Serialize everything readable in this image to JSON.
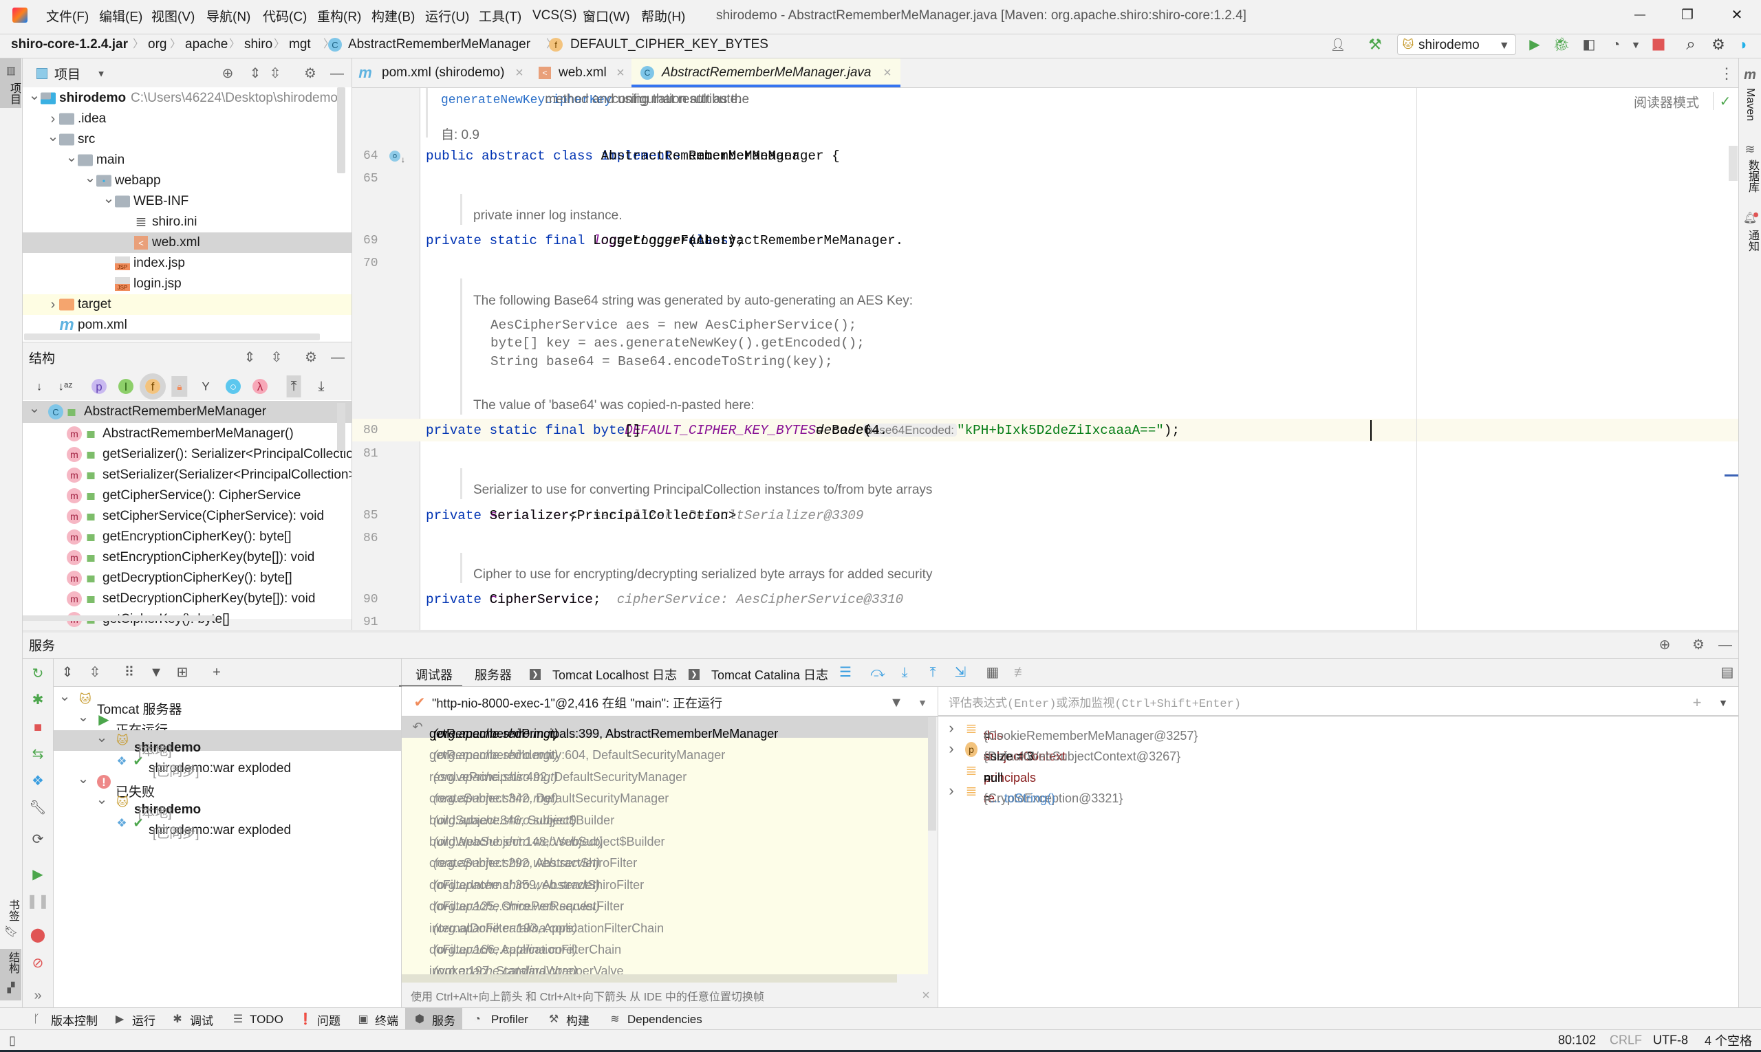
{
  "window": {
    "title": "shirodemo - AbstractRememberMeManager.java [Maven: org.apache.shiro:shiro-core:1.2.4]",
    "menu": [
      "文件(F)",
      "编辑(E)",
      "视图(V)",
      "导航(N)",
      "代码(C)",
      "重构(R)",
      "构建(B)",
      "运行(U)",
      "工具(T)",
      "VCS(S)",
      "窗口(W)",
      "帮助(H)"
    ]
  },
  "breadcrumb": [
    "shiro-core-1.2.4.jar",
    "org",
    "apache",
    "shiro",
    "mgt",
    "AbstractRememberMeManager",
    "DEFAULT_CIPHER_KEY_BYTES"
  ],
  "toolbar": {
    "run_config": "shirodemo"
  },
  "left_strip": {
    "project": "项目",
    "bookmarks": "书签",
    "structure": "结构"
  },
  "right_strip": {
    "maven": "Maven",
    "database": "数据库",
    "notifications": "通知"
  },
  "project": {
    "title": "项目",
    "tree": [
      {
        "label": "shirodemo",
        "path": "C:\\Users\\46224\\Desktop\\shirodemo",
        "depth": 0,
        "icon": "module-folder",
        "expanded": true,
        "bold": true
      },
      {
        "label": ".idea",
        "depth": 1,
        "icon": "folder",
        "expanded": false
      },
      {
        "label": "src",
        "depth": 1,
        "icon": "folder",
        "expanded": true
      },
      {
        "label": "main",
        "depth": 2,
        "icon": "folder",
        "expanded": true
      },
      {
        "label": "webapp",
        "depth": 3,
        "icon": "web-folder",
        "expanded": true
      },
      {
        "label": "WEB-INF",
        "depth": 4,
        "icon": "folder",
        "expanded": true
      },
      {
        "label": "shiro.ini",
        "depth": 5,
        "icon": "ini-file"
      },
      {
        "label": "web.xml",
        "depth": 5,
        "icon": "xml-file",
        "selected": true
      },
      {
        "label": "index.jsp",
        "depth": 4,
        "icon": "jsp-file"
      },
      {
        "label": "login.jsp",
        "depth": 4,
        "icon": "jsp-file"
      },
      {
        "label": "target",
        "depth": 1,
        "icon": "excluded-folder",
        "expanded": false,
        "highlighted": true
      },
      {
        "label": "pom.xml",
        "depth": 1,
        "icon": "maven-file"
      }
    ]
  },
  "structure": {
    "title": "结构",
    "class_name": "AbstractRememberMeManager",
    "members": [
      "AbstractRememberMeManager()",
      "getSerializer(): Serializer<PrincipalCollection>",
      "setSerializer(Serializer<PrincipalCollection>): void",
      "getCipherService(): CipherService",
      "setCipherService(CipherService): void",
      "getEncryptionCipherKey(): byte[]",
      "setEncryptionCipherKey(byte[]): void",
      "getDecryptionCipherKey(): byte[]",
      "setDecryptionCipherKey(byte[]): void",
      "getCipherKey(): byte[]"
    ]
  },
  "editor": {
    "tabs": [
      {
        "label": "pom.xml (shirodemo)",
        "icon": "maven-icon"
      },
      {
        "label": "web.xml",
        "icon": "xml-icon"
      },
      {
        "label": "AbstractRememberMeManager.java",
        "icon": "class-icon",
        "active": true
      }
    ],
    "reader_mode": "阅读器模式",
    "rows": [
      {
        "kind": "doc",
        "tokens": [
          {
            "t": "generateNewKey",
            "c": "doclink"
          },
          {
            "t": " method and using that result as the "
          },
          {
            "t": "cipherKey",
            "c": "doclink"
          },
          {
            "t": " configuration attribute."
          }
        ]
      },
      {
        "kind": "doc",
        "tokens": [
          {
            "t": "自: 0.9"
          }
        ]
      },
      {
        "kind": "code",
        "num": "64",
        "tokens": [
          {
            "t": "public abstract class ",
            "c": "kw"
          },
          {
            "t": "AbstractRememberMeManager "
          },
          {
            "t": "implements ",
            "c": "kw"
          },
          {
            "t": "RememberMeManager {"
          }
        ]
      },
      {
        "kind": "code",
        "num": "65",
        "tokens": []
      },
      {
        "kind": "doc",
        "tokens": [
          {
            "t": "private inner log instance."
          }
        ]
      },
      {
        "kind": "code",
        "num": "69",
        "tokens": [
          {
            "t": "    "
          },
          {
            "t": "private static final ",
            "c": "kw"
          },
          {
            "t": "Logger "
          },
          {
            "t": "log",
            "c": "fld it"
          },
          {
            "t": " = LoggerFactory."
          },
          {
            "t": "getLogger",
            "c": "it"
          },
          {
            "t": "(AbstractRememberMeManager."
          },
          {
            "t": "class",
            "c": "kw"
          },
          {
            "t": ");"
          }
        ]
      },
      {
        "kind": "code",
        "num": "70",
        "tokens": []
      },
      {
        "kind": "doc",
        "tokens": [
          {
            "t": "The following Base64 string was generated by auto-generating an AES Key:"
          }
        ]
      },
      {
        "kind": "docmono",
        "tokens": [
          {
            "t": "AesCipherService aes = new AesCipherService();"
          }
        ]
      },
      {
        "kind": "docmono",
        "tokens": [
          {
            "t": "byte[] key = aes.generateNewKey().getEncoded();"
          }
        ]
      },
      {
        "kind": "docmono",
        "tokens": [
          {
            "t": "String base64 = Base64.encodeToString(key);"
          }
        ]
      },
      {
        "kind": "doc",
        "tokens": [
          {
            "t": "The value of 'base64' was copied-n-pasted here:"
          }
        ]
      },
      {
        "kind": "code",
        "num": "80",
        "current": true,
        "tokens": [
          {
            "t": "    "
          },
          {
            "t": "private static final byte",
            "c": "kw"
          },
          {
            "t": "[] "
          },
          {
            "t": "DEFAULT_CIPHER_KEY_BYTES",
            "c": "fld it"
          },
          {
            "t": " = Base64."
          },
          {
            "t": "decode",
            "c": "it"
          },
          {
            "t": "( "
          },
          {
            "t": "base64Encoded:",
            "c": "inlay"
          },
          {
            "t": " "
          },
          {
            "t": "\"kPH+bIxk5D2deZiIxcaaaA==\"",
            "c": "str"
          },
          {
            "t": ");"
          }
        ]
      },
      {
        "kind": "code",
        "num": "81",
        "tokens": []
      },
      {
        "kind": "doc",
        "tokens": [
          {
            "t": "Serializer to use for converting PrincipalCollection instances to/from byte arrays"
          }
        ]
      },
      {
        "kind": "code",
        "num": "85",
        "tokens": [
          {
            "t": "    "
          },
          {
            "t": "private ",
            "c": "kw"
          },
          {
            "t": "Serializer<PrincipalCollection> "
          },
          {
            "t": "serializer",
            "c": "fld"
          },
          {
            "t": ";"
          },
          {
            "t": "   serializer: DefaultSerializer@3309",
            "c": "hint"
          }
        ]
      },
      {
        "kind": "code",
        "num": "86",
        "tokens": []
      },
      {
        "kind": "doc",
        "tokens": [
          {
            "t": "Cipher to use for encrypting/decrypting serialized byte arrays for added security"
          }
        ]
      },
      {
        "kind": "code",
        "num": "90",
        "tokens": [
          {
            "t": "    "
          },
          {
            "t": "private ",
            "c": "kw"
          },
          {
            "t": "CipherService "
          },
          {
            "t": "cipherService",
            "c": "fld"
          },
          {
            "t": ";"
          },
          {
            "t": "   cipherService: AesCipherService@3310",
            "c": "hint"
          }
        ]
      },
      {
        "kind": "code",
        "num": "91",
        "tokens": []
      }
    ]
  },
  "services": {
    "title": "服务",
    "tree": [
      {
        "label": "Tomcat 服务器",
        "depth": 0,
        "icon": "tomcat-icon",
        "expanded": true
      },
      {
        "label": "正在运行",
        "depth": 1,
        "icon": "running-icon",
        "expanded": true
      },
      {
        "label": "shirodemo",
        "suffix": "[本地]",
        "depth": 2,
        "icon": "tomcat-run-icon",
        "expanded": true,
        "bold": true,
        "selected": true
      },
      {
        "label": "shirodemo:war exploded",
        "suffix": "[已同步]",
        "depth": 3,
        "icon": "artifact-icon"
      },
      {
        "label": "已失败",
        "depth": 1,
        "icon": "failed-icon",
        "expanded": true
      },
      {
        "label": "shirodemo",
        "suffix": "[本地]",
        "depth": 2,
        "icon": "tomcat-run-icon",
        "expanded": true,
        "bold": true
      },
      {
        "label": "shirodemo:war exploded",
        "suffix": "[已同步]",
        "depth": 3,
        "icon": "artifact-icon"
      }
    ]
  },
  "debugger": {
    "tabs": [
      "调试器",
      "服务器",
      "Tomcat Localhost 日志",
      "Tomcat Catalina 日志"
    ],
    "thread": "\"http-nio-8000-exec-1\"@2,416 在组 \"main\": 正在运行",
    "frames": [
      {
        "method": "getRememberedPrincipals:399, AbstractRememberMeManager",
        "pkg": "(org.apache.shiro.mgt)",
        "current": true
      },
      {
        "method": "getRememberedIdentity:604, DefaultSecurityManager",
        "pkg": "(org.apache.shiro.mgt)"
      },
      {
        "method": "resolvePrincipals:492, DefaultSecurityManager",
        "pkg": "(org.apache.shiro.mgt)"
      },
      {
        "method": "createSubject:342, DefaultSecurityManager",
        "pkg": "(org.apache.shiro.mgt)"
      },
      {
        "method": "buildSubject:846, Subject$Builder",
        "pkg": "(org.apache.shiro.subject)"
      },
      {
        "method": "buildWebSubject:148, WebSubject$Builder",
        "pkg": "(org.apache.shiro.web.subject)"
      },
      {
        "method": "createSubject:292, AbstractShiroFilter",
        "pkg": "(org.apache.shiro.web.servlet)"
      },
      {
        "method": "doFilterInternal:359, AbstractShiroFilter",
        "pkg": "(org.apache.shiro.web.servlet)"
      },
      {
        "method": "doFilter:125, OncePerRequestFilter",
        "pkg": "(org.apache.shiro.web.servlet)"
      },
      {
        "method": "internalDoFilter:193, ApplicationFilterChain",
        "pkg": "(org.apache.catalina.core)"
      },
      {
        "method": "doFilter:166, ApplicationFilterChain",
        "pkg": "(org.apache.catalina.core)"
      },
      {
        "method": "invoke:197, StandardWrapperValve",
        "pkg": "(org.apache.catalina.core)"
      }
    ],
    "hint": "使用 Ctrl+Alt+向上箭头 和 Ctrl+Alt+向下箭头 从 IDE 中的任意位置切换帧",
    "eval_placeholder": "评估表达式(Enter)或添加监视(Ctrl+Shift+Enter)",
    "variables": [
      {
        "name": "this",
        "value": "{CookieRememberMeManager@3257}",
        "expandable": true,
        "icon": "field"
      },
      {
        "name": "subjectContext",
        "value": "{DefaultWebSubjectContext@3267}",
        "extra": "size = 3",
        "expandable": true,
        "icon": "param"
      },
      {
        "name": "principals",
        "value": "null",
        "expandable": false,
        "icon": "field",
        "plain": true
      },
      {
        "name": "re",
        "value": "{CryptoException@3321}",
        "link": "... toString()",
        "expandable": true,
        "icon": "field"
      }
    ]
  },
  "bottom_tabs": [
    "版本控制",
    "运行",
    "调试",
    "TODO",
    "问题",
    "终端",
    "服务",
    "Profiler",
    "构建",
    "Dependencies"
  ],
  "status": {
    "position": "80:102",
    "line_sep": "CRLF",
    "encoding": "UTF-8",
    "indent": "4 个空格"
  },
  "colors": {
    "accent": "#3574f0",
    "keyword": "#0033b3",
    "field": "#871094",
    "string": "#067d17",
    "frames_bg": "#fdfde8",
    "stop": "#e05555",
    "run": "#4ca64c"
  }
}
